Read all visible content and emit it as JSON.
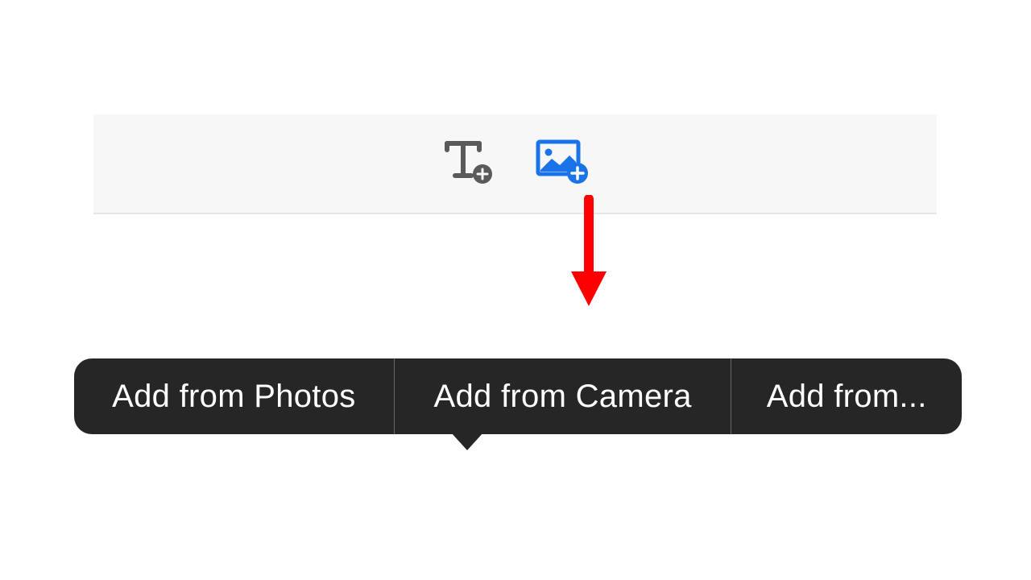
{
  "toolbar": {
    "add_text_icon": "add-text-icon",
    "add_image_icon": "add-image-icon"
  },
  "popover": {
    "items": [
      {
        "label": "Add from Photos"
      },
      {
        "label": "Add from Camera"
      },
      {
        "label": "Add from..."
      }
    ]
  },
  "colors": {
    "accent": "#1a73e8",
    "toolbar_icon": "#5a5a5a",
    "arrow": "#ff0000",
    "popover_bg": "#262626"
  }
}
